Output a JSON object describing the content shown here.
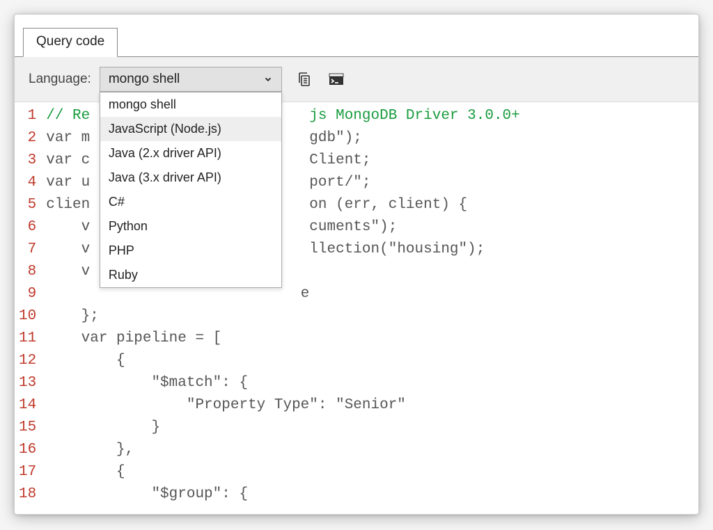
{
  "tab": {
    "label": "Query code"
  },
  "toolbar": {
    "language_label": "Language:",
    "selected": "mongo shell"
  },
  "dropdown": {
    "items": [
      "mongo shell",
      "JavaScript (Node.js)",
      "Java (2.x driver API)",
      "Java (3.x driver API)",
      "C#",
      "Python",
      "PHP",
      "Ruby"
    ],
    "highlighted_index": 1
  },
  "editor": {
    "line_start": 1,
    "line_count": 18,
    "code_lines": [
      {
        "pre": "// Re",
        "comment_tail": "js MongoDB Driver 3.0.0+"
      },
      {
        "pre": "var m",
        "tail": "gdb\");"
      },
      {
        "pre": "var c",
        "tail": "Client;"
      },
      {
        "pre": "var u",
        "tail": "port/\";"
      },
      {
        "pre": "clien",
        "tail": "on (err, client) {"
      },
      {
        "pre": "    v",
        "tail": "cuments\");"
      },
      {
        "pre": "    v",
        "tail": "llection(\"housing\");"
      },
      {
        "pre": "    v",
        "tail": ""
      },
      {
        "pre": "    ",
        "tail": "e"
      },
      {
        "full": "    };"
      },
      {
        "full": "    var pipeline = ["
      },
      {
        "full": "        {"
      },
      {
        "full": "            \"$match\": {"
      },
      {
        "full": "                \"Property Type\": \"Senior\""
      },
      {
        "full": "            }"
      },
      {
        "full": "        },"
      },
      {
        "full": "        {"
      },
      {
        "full": "            \"$group\": {"
      }
    ]
  }
}
